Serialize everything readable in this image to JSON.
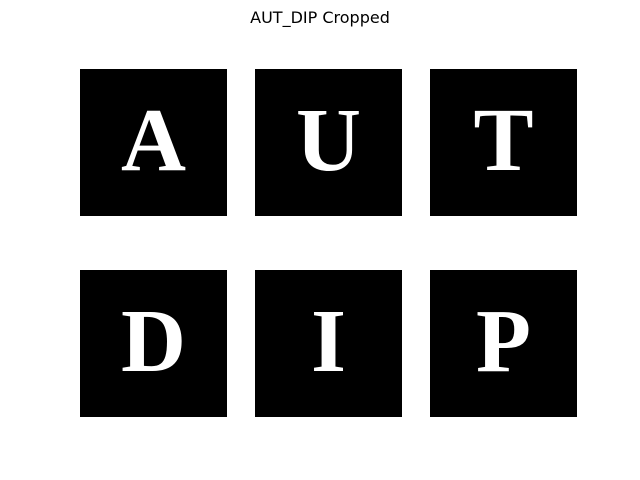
{
  "figure": {
    "title": "AUT_DIP Cropped"
  },
  "tiles": [
    {
      "letter": "A"
    },
    {
      "letter": "U"
    },
    {
      "letter": "T"
    },
    {
      "letter": "D"
    },
    {
      "letter": "I"
    },
    {
      "letter": "P"
    }
  ],
  "colors": {
    "page_background": "#ffffff",
    "tile_background": "#000000",
    "letter": "#ffffff",
    "title": "#000000"
  }
}
